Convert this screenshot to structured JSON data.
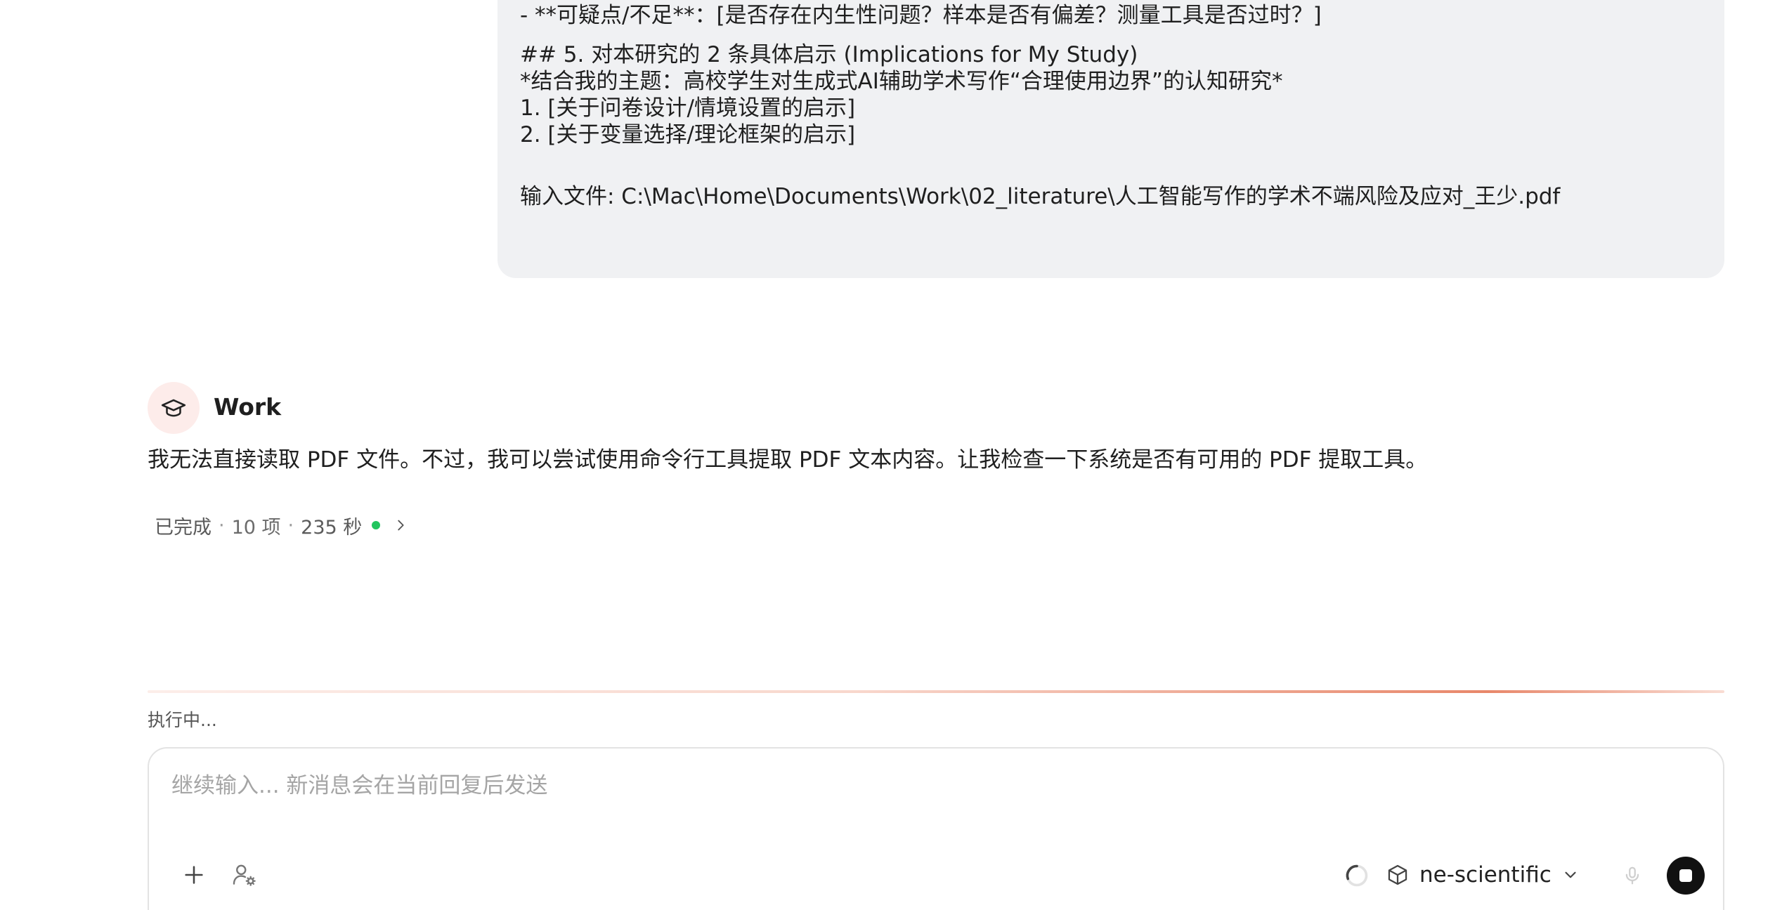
{
  "user_message": {
    "lines": [
      "- **可疑点/不足**：[是否存在内生性问题？样本是否有偏差？测量工具是否过时？]",
      "## 5. 对本研究的 2 条具体启示 (Implications for My Study)",
      "*结合我的主题：高校学生对生成式AI辅助学术写作“合理使用边界”的认知研究*",
      "1. [关于问卷设计/情境设置的启示]",
      "2. [关于变量选择/理论框架的启示]",
      "输入文件: C:\\Mac\\Home\\Documents\\Work\\02_literature\\人工智能写作的学术不端风险及应对_王少.pdf"
    ]
  },
  "assistant": {
    "name": "Work",
    "avatar_icon": "graduation-cap-icon",
    "message": "我无法直接读取 PDF 文件。不过，我可以尝试使用命令行工具提取 PDF 文本内容。让我检查一下系统是否有可用的 PDF 提取工具。",
    "status": {
      "state": "已完成",
      "items": "10 项",
      "duration": "235 秒",
      "dot_color": "#22c55e"
    }
  },
  "execution": {
    "label": "执行中..."
  },
  "composer": {
    "placeholder": "继续输入... 新消息会在当前回复后发送",
    "model_name": "ne-scientific",
    "icons": {
      "add": "plus-icon",
      "persona": "user-settings-icon",
      "loading": "spinner-icon",
      "model": "cube-icon",
      "mic": "microphone-icon",
      "stop": "stop-icon"
    }
  },
  "colors": {
    "bubble_bg": "#f0f1f3",
    "avatar_bg": "#fdecea",
    "accent": "#e8876a",
    "status_green": "#22c55e"
  }
}
